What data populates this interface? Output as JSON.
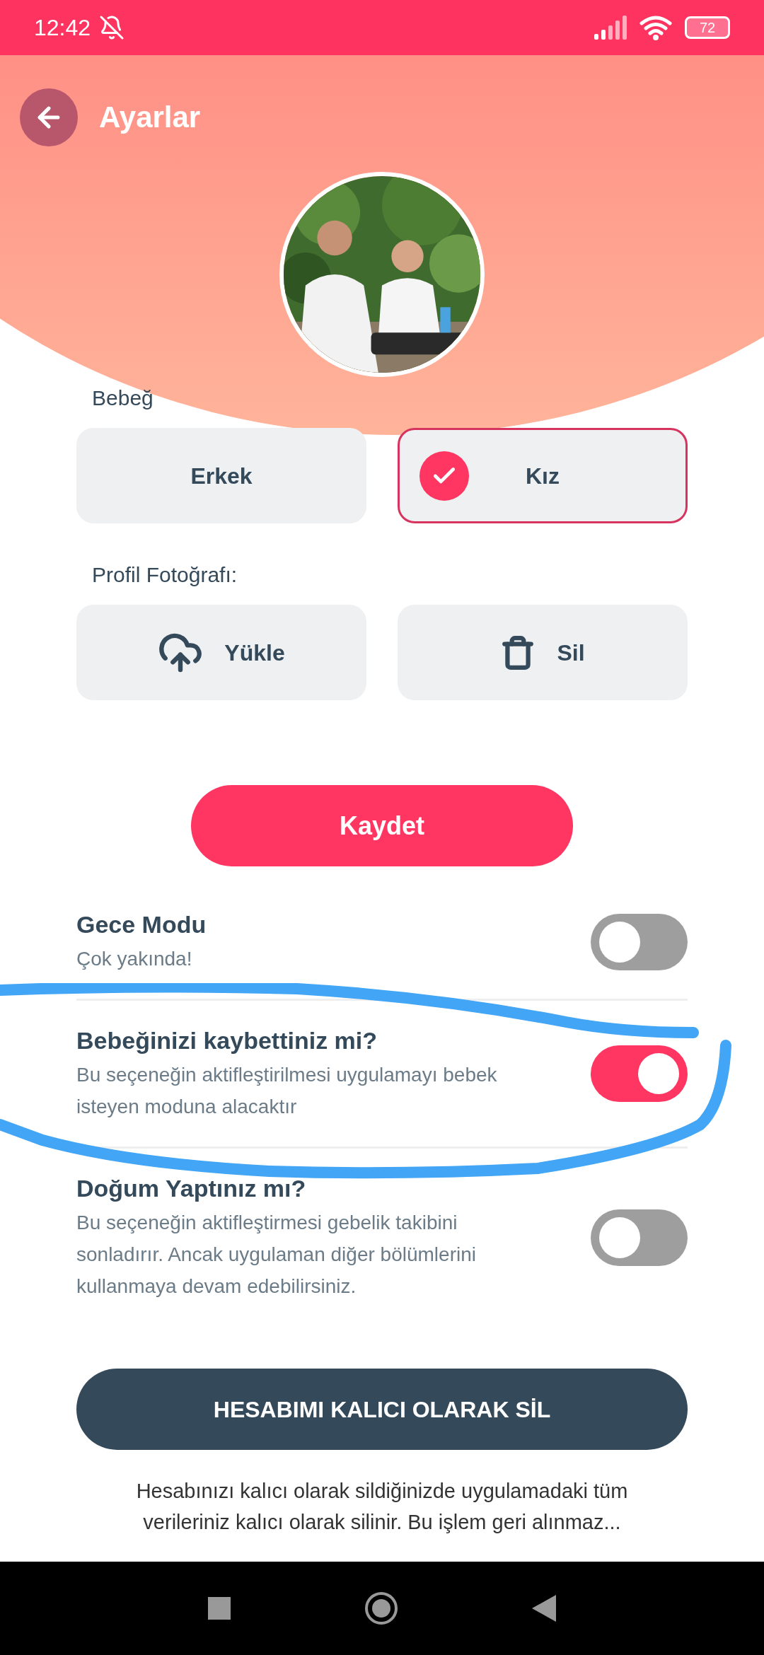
{
  "status_bar": {
    "time": "12:42",
    "battery": "72"
  },
  "header": {
    "title": "Ayarlar"
  },
  "gender": {
    "label": "Bebeğ",
    "options": [
      {
        "label": "Erkek",
        "selected": false
      },
      {
        "label": "Kız",
        "selected": true
      }
    ]
  },
  "photo": {
    "label": "Profil Fotoğrafı:",
    "actions": [
      {
        "kind": "upload",
        "label": "Yükle"
      },
      {
        "kind": "delete",
        "label": "Sil"
      }
    ]
  },
  "save_button": "Kaydet",
  "settings": [
    {
      "title": "Gece Modu",
      "description": "Çok yakında!",
      "on": false
    },
    {
      "title": "Bebeğinizi kaybettiniz mi?",
      "description": "Bu seçeneğin aktifleştirilmesi uygulamayı bebek isteyen moduna alacaktır",
      "on": true
    },
    {
      "title": "Doğum Yaptınız mı?",
      "description": "Bu seçeneğin aktifleştirmesi gebelik takibini sonladırır. Ancak uygulaman diğer bölümlerini kullanmaya devam edebilirsiniz.",
      "on": false
    }
  ],
  "delete_account": {
    "button": "HESABIMI KALICI OLARAK SİL",
    "note": "Hesabınızı kalıcı olarak sildiğinizde uygulamadaki tüm verileriniz kalıcı olarak silinir. Bu işlem geri alınmaz..."
  }
}
